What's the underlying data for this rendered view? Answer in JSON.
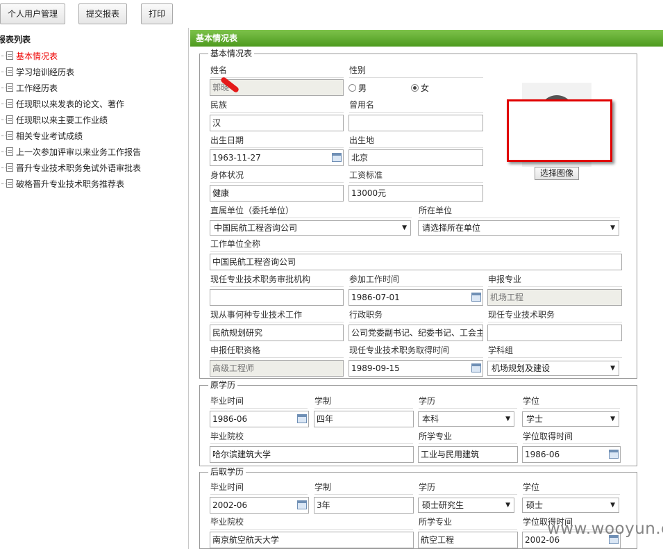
{
  "toolbar": {
    "btn_user": "个人用户管理",
    "btn_submit": "提交报表",
    "btn_print": "打印"
  },
  "sidebar": {
    "title": "报表列表",
    "items": [
      {
        "label": "基本情况表",
        "active": true
      },
      {
        "label": "学习培训经历表"
      },
      {
        "label": "工作经历表"
      },
      {
        "label": "任现职以来发表的论文、著作"
      },
      {
        "label": "任现职以来主要工作业绩"
      },
      {
        "label": "相关专业考试成绩"
      },
      {
        "label": "上一次参加评审以来业务工作报告"
      },
      {
        "label": "晋升专业技术职务免试外语审批表"
      },
      {
        "label": "破格晋升专业技术职务推荐表"
      }
    ]
  },
  "main": {
    "header": "基本情况表",
    "basic": {
      "legend": "基本情况表",
      "name_label": "姓名",
      "name_value": "郭晓",
      "gender_label": "性别",
      "gender_male": "男",
      "gender_female": "女",
      "gender_selected": "女",
      "ethnicity_label": "民族",
      "ethnicity_value": "汉",
      "former_name_label": "曾用名",
      "former_name_value": "",
      "birthdate_label": "出生日期",
      "birthdate_value": "1963-11-27",
      "birthplace_label": "出生地",
      "birthplace_value": "北京",
      "health_label": "身体状况",
      "health_value": "健康",
      "salary_label": "工资标准",
      "salary_value": "13000元",
      "unit_label": "直属单位（委托单位）",
      "unit_value": "中国民航工程咨询公司",
      "location_unit_label": "所在单位",
      "location_unit_value": "请选择所在单位",
      "full_unit_label": "工作单位全称",
      "full_unit_value": "中国民航工程咨询公司",
      "approval_org_label": "现任专业技术职务审批机构",
      "approval_org_value": "",
      "work_start_label": "参加工作时间",
      "work_start_value": "1986-07-01",
      "apply_major_label": "申报专业",
      "apply_major_value": "机场工程",
      "current_work_label": "现从事何种专业技术工作",
      "current_work_value": "民航规划研究",
      "admin_post_label": "行政职务",
      "admin_post_value": "公司党委副书记、纪委书记、工会主",
      "current_title_label": "现任专业技术职务",
      "current_title_value": "",
      "apply_qual_label": "申报任职资格",
      "apply_qual_value": "高级工程师",
      "title_date_label": "现任专业技术职务取得时间",
      "title_date_value": "1989-09-15",
      "discipline_label": "学科组",
      "discipline_value": "机场规划及建设",
      "photo_button": "选择图像"
    },
    "original_edu": {
      "legend": "原学历",
      "grad_time_label": "毕业时间",
      "grad_time_value": "1986-06",
      "duration_label": "学制",
      "duration_value": "四年",
      "degree_level_label": "学历",
      "degree_level_value": "本科",
      "degree_label": "学位",
      "degree_value": "学士",
      "school_label": "毕业院校",
      "school_value": "哈尔滨建筑大学",
      "major_label": "所学专业",
      "major_value": "工业与民用建筑",
      "degree_date_label": "学位取得时间",
      "degree_date_value": "1986-06"
    },
    "later_edu": {
      "legend": "后取学历",
      "grad_time_label": "毕业时间",
      "grad_time_value": "2002-06",
      "duration_label": "学制",
      "duration_value": "3年",
      "degree_level_label": "学历",
      "degree_level_value": "硕士研究生",
      "degree_label": "学位",
      "degree_value": "硕士",
      "school_label": "毕业院校",
      "school_value": "南京航空航天大学",
      "major_label": "所学专业",
      "major_value": "航空工程",
      "degree_date_label": "学位取得时间",
      "degree_date_value": "2002-06"
    }
  },
  "watermark": "www.wooyun.org"
}
